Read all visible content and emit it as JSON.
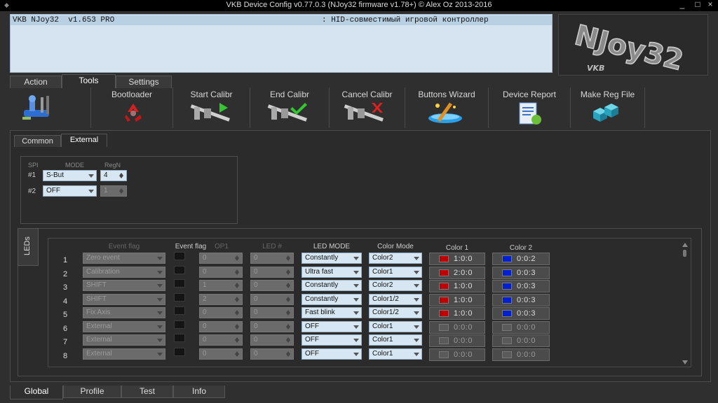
{
  "window": {
    "title": "VKB Device Config v0.77.0.3 (NJoy32 firmware v1.78+) © Alex Oz 2013-2016",
    "minimize": "_",
    "maximize": "□",
    "close": "×"
  },
  "device_list": {
    "device": "VKB NJoy32  v1.653 PRO",
    "description": ": HID-совместимый игровой контроллер"
  },
  "logo": {
    "text": "NJoy32",
    "sub": "VKB"
  },
  "main_tabs": [
    {
      "label": "Action"
    },
    {
      "label": "Tools"
    },
    {
      "label": "Settings"
    }
  ],
  "toolbar": [
    {
      "label": "",
      "icon": "joystick-tools-icon"
    },
    {
      "label": "Bootloader",
      "icon": "recycle-icon"
    },
    {
      "label": "Start Calibr",
      "icon": "caliper-play-icon"
    },
    {
      "label": "End Calibr",
      "icon": "caliper-check-icon"
    },
    {
      "label": "Cancel Calibr",
      "icon": "caliper-cancel-icon"
    },
    {
      "label": "Buttons Wizard",
      "icon": "wizard-wand-icon"
    },
    {
      "label": "Device Report",
      "icon": "report-document-icon"
    },
    {
      "label": "Make Reg File",
      "icon": "registry-cubes-icon"
    }
  ],
  "sub_tabs": [
    {
      "label": "Common"
    },
    {
      "label": "External"
    }
  ],
  "spi": {
    "headers": {
      "spi": "SPI",
      "mode": "MODE",
      "regn": "RegN"
    },
    "rows": [
      {
        "num": "#1",
        "mode": "S-But",
        "regn": "4"
      },
      {
        "num": "#2",
        "mode": "OFF",
        "regn": "1"
      }
    ]
  },
  "leds": {
    "tab_label": "LEDs",
    "headers": {
      "event_flag_combo": "Event flag",
      "event_flag": "Event flag",
      "op1": "OP1",
      "led_num": "LED #",
      "led_mode": "LED MODE",
      "color_mode": "Color Mode",
      "color1": "Color 1",
      "color2": "Color 2"
    },
    "rows": [
      {
        "num": "1",
        "event": "Zero event",
        "op1": "0",
        "led": "0",
        "mode": "Constantly",
        "cmode": "Color2",
        "c1": "1:0:0",
        "c1color": "#c00000",
        "c2": "0:0:2",
        "c2color": "#0020d0"
      },
      {
        "num": "2",
        "event": "Calibration",
        "op1": "0",
        "led": "0",
        "mode": "Ultra fast",
        "cmode": "Color1",
        "c1": "2:0:0",
        "c1color": "#c00000",
        "c2": "0:0:3",
        "c2color": "#0020d0"
      },
      {
        "num": "3",
        "event": "SHIFT",
        "op1": "1",
        "led": "0",
        "mode": "Constantly",
        "cmode": "Color2",
        "c1": "1:0:0",
        "c1color": "#c00000",
        "c2": "0:0:3",
        "c2color": "#0020d0"
      },
      {
        "num": "4",
        "event": "SHIFT",
        "op1": "2",
        "led": "0",
        "mode": "Constantly",
        "cmode": "Color1/2",
        "c1": "1:0:0",
        "c1color": "#c00000",
        "c2": "0:0:3",
        "c2color": "#0020d0"
      },
      {
        "num": "5",
        "event": "Fix Axis",
        "op1": "0",
        "led": "0",
        "mode": "Fast blink",
        "cmode": "Color1/2",
        "c1": "1:0:0",
        "c1color": "#c00000",
        "c2": "0:0:3",
        "c2color": "#0020d0"
      },
      {
        "num": "6",
        "event": "External",
        "op1": "0",
        "led": "0",
        "mode": "OFF",
        "cmode": "Color1",
        "c1": "0:0:0",
        "c1color": "#5a5a5a",
        "c2": "0:0:0",
        "c2color": "#5a5a5a"
      },
      {
        "num": "7",
        "event": "External",
        "op1": "0",
        "led": "0",
        "mode": "OFF",
        "cmode": "Color1",
        "c1": "0:0:0",
        "c1color": "#5a5a5a",
        "c2": "0:0:0",
        "c2color": "#5a5a5a"
      },
      {
        "num": "8",
        "event": "External",
        "op1": "0",
        "led": "0",
        "mode": "OFF",
        "cmode": "Color1",
        "c1": "0:0:0",
        "c1color": "#5a5a5a",
        "c2": "0:0:0",
        "c2color": "#5a5a5a"
      }
    ]
  },
  "bottom_tabs": [
    {
      "label": "Global"
    },
    {
      "label": "Profile"
    },
    {
      "label": "Test"
    },
    {
      "label": "Info"
    }
  ]
}
